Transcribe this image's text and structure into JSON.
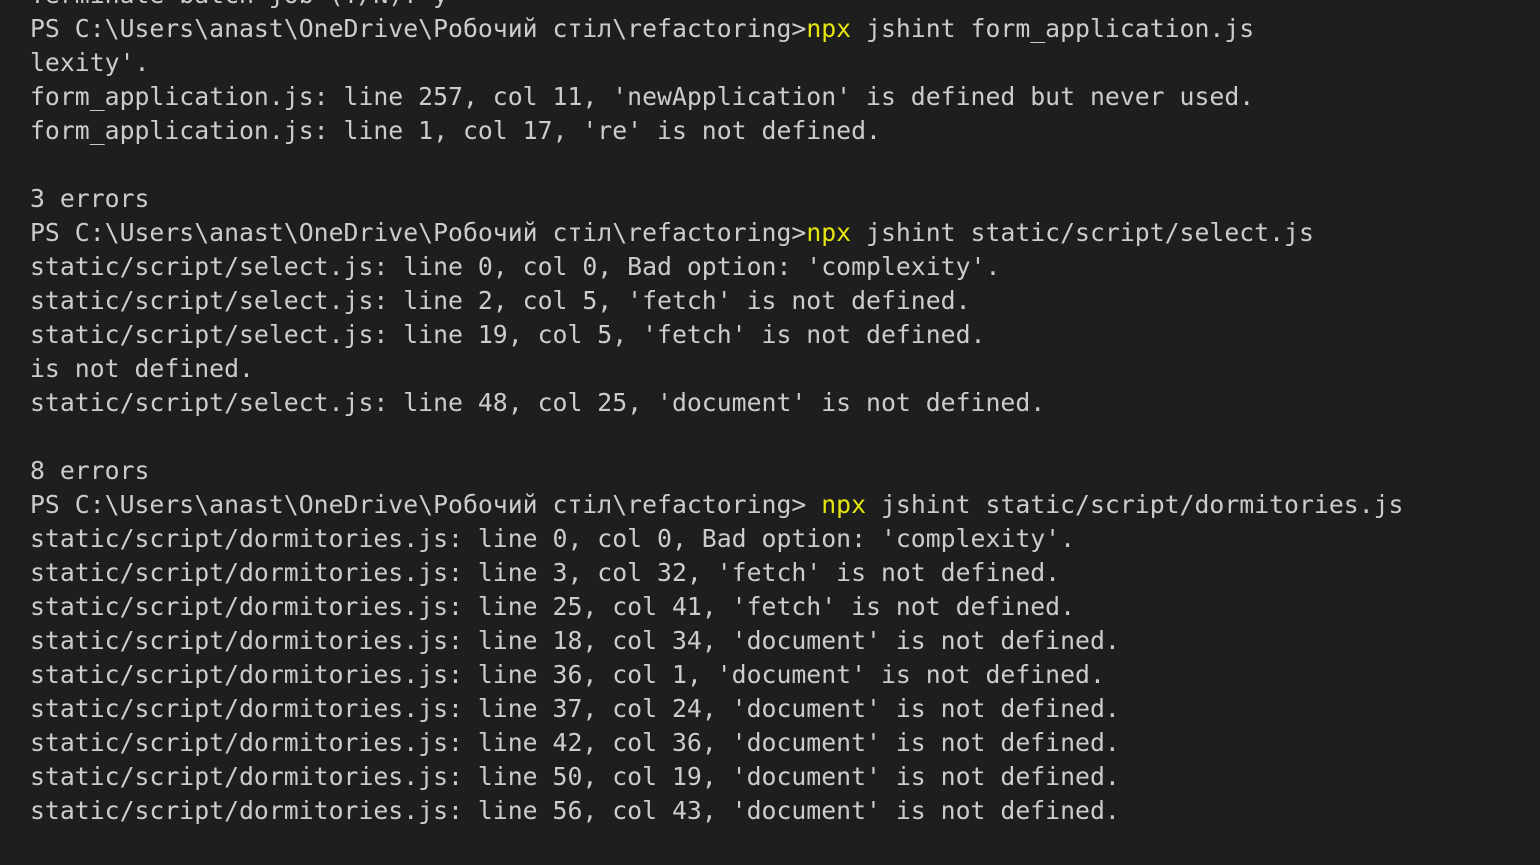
{
  "colors": {
    "background": "#1e1e1e",
    "text": "#cccccc",
    "command": "#e5e510"
  },
  "lines": [
    {
      "text": "Terminate batch job (Y/N)? y"
    },
    {
      "prompt": "PS C:\\Users\\anast\\OneDrive\\Робочий стіл\\refactoring>",
      "cmd": "npx",
      "args": " jshint form_application.js"
    },
    {
      "text": "lexity'."
    },
    {
      "text": "form_application.js: line 257, col 11, 'newApplication' is defined but never used."
    },
    {
      "text": "form_application.js: line 1, col 17, 're' is not defined."
    },
    {
      "text": ""
    },
    {
      "text": "3 errors"
    },
    {
      "prompt": "PS C:\\Users\\anast\\OneDrive\\Робочий стіл\\refactoring>",
      "cmd": "npx",
      "args": " jshint static/script/select.js"
    },
    {
      "text": "static/script/select.js: line 0, col 0, Bad option: 'complexity'."
    },
    {
      "text": "static/script/select.js: line 2, col 5, 'fetch' is not defined."
    },
    {
      "text": "static/script/select.js: line 19, col 5, 'fetch' is not defined."
    },
    {
      "text": "is not defined."
    },
    {
      "text": "static/script/select.js: line 48, col 25, 'document' is not defined."
    },
    {
      "text": ""
    },
    {
      "text": "8 errors"
    },
    {
      "prompt": "PS C:\\Users\\anast\\OneDrive\\Робочий стіл\\refactoring> ",
      "cmd": "npx",
      "args": " jshint static/script/dormitories.js"
    },
    {
      "text": "static/script/dormitories.js: line 0, col 0, Bad option: 'complexity'."
    },
    {
      "text": "static/script/dormitories.js: line 3, col 32, 'fetch' is not defined."
    },
    {
      "text": "static/script/dormitories.js: line 25, col 41, 'fetch' is not defined."
    },
    {
      "text": "static/script/dormitories.js: line 18, col 34, 'document' is not defined."
    },
    {
      "text": "static/script/dormitories.js: line 36, col 1, 'document' is not defined."
    },
    {
      "text": "static/script/dormitories.js: line 37, col 24, 'document' is not defined."
    },
    {
      "text": "static/script/dormitories.js: line 42, col 36, 'document' is not defined."
    },
    {
      "text": "static/script/dormitories.js: line 50, col 19, 'document' is not defined."
    },
    {
      "text": "static/script/dormitories.js: line 56, col 43, 'document' is not defined."
    }
  ]
}
